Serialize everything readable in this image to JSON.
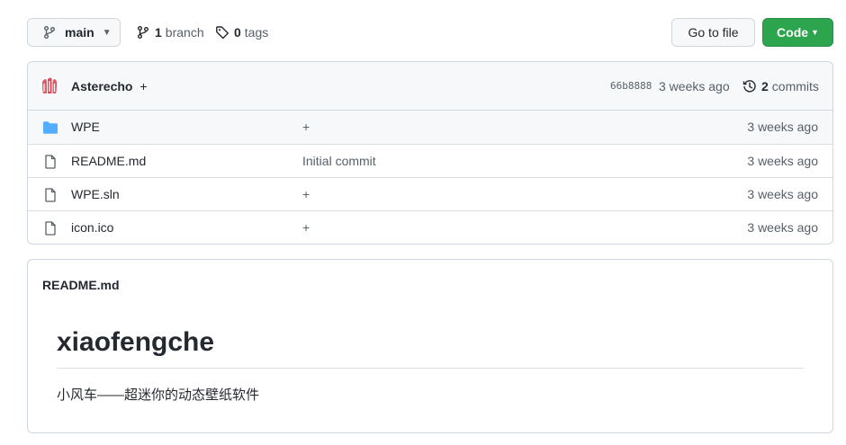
{
  "toolbar": {
    "branch_label": "main",
    "branch_count": "1",
    "branch_word": "branch",
    "tag_count": "0",
    "tag_word": "tags",
    "goto_label": "Go to file",
    "code_label": "Code"
  },
  "commit": {
    "author": "Asterecho",
    "message": "+",
    "sha": "66b8888",
    "time": "3 weeks ago",
    "count": "2",
    "count_word": "commits"
  },
  "files": [
    {
      "name": "WPE",
      "type": "folder",
      "message": "+",
      "time": "3 weeks ago"
    },
    {
      "name": "README.md",
      "type": "file",
      "message": "Initial commit",
      "time": "3 weeks ago"
    },
    {
      "name": "WPE.sln",
      "type": "file",
      "message": "+",
      "time": "3 weeks ago"
    },
    {
      "name": "icon.ico",
      "type": "file",
      "message": "+",
      "time": "3 weeks ago"
    }
  ],
  "readme": {
    "filename": "README.md",
    "title": "xiaofengche",
    "text": "小风车——超迷你的动态壁纸软件"
  },
  "colors": {
    "accent_green": "#2da44e",
    "folder_blue": "#54aeff",
    "muted": "#57606a"
  }
}
